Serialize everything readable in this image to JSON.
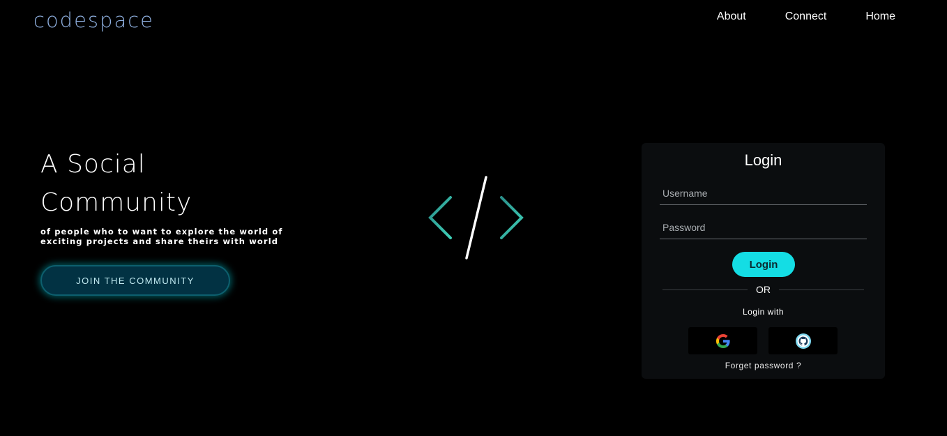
{
  "header": {
    "brand": "codespace",
    "nav": [
      {
        "label": "About"
      },
      {
        "label": "Connect"
      },
      {
        "label": "Home"
      }
    ]
  },
  "hero": {
    "title_line1": "A Social",
    "title_line2": "Community",
    "subtitle_line1": "of people who to want to explore the world of",
    "subtitle_line2": "exciting projects and share theirs with world",
    "cta_label": "JOIN THE COMMUNITY"
  },
  "login": {
    "title": "Login",
    "username_placeholder": "Username",
    "password_placeholder": "Password",
    "submit_label": "Login",
    "or_label": "OR",
    "login_with_label": "Login with",
    "social": [
      {
        "icon": "google-icon"
      },
      {
        "icon": "github-icon"
      }
    ],
    "forget_label": "Forget password ?"
  },
  "colors": {
    "background": "#000000",
    "brand": "#8fb0e0",
    "accent": "#14dde4",
    "card": "#0b0d0f",
    "cta_bg": "#023243"
  }
}
